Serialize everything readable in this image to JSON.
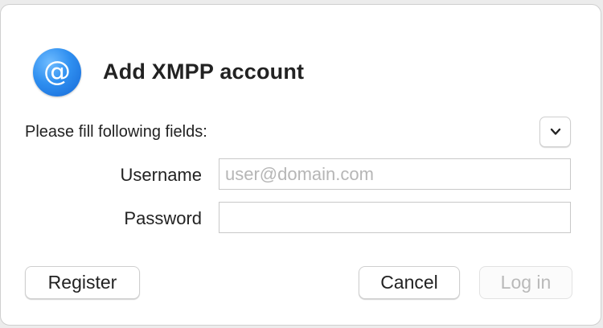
{
  "dialog": {
    "title": "Add XMPP account",
    "icon": "at-sign-icon",
    "prompt": "Please fill following fields:",
    "disclosure_icon": "chevron-down-icon"
  },
  "form": {
    "username_label": "Username",
    "username_placeholder": "user@domain.com",
    "username_value": "",
    "password_label": "Password",
    "password_value": ""
  },
  "buttons": {
    "register": "Register",
    "cancel": "Cancel",
    "login": "Log in",
    "login_enabled": false
  },
  "colors": {
    "icon_blue": "#2f8ff0",
    "disabled_text": "#b9b9b9"
  }
}
